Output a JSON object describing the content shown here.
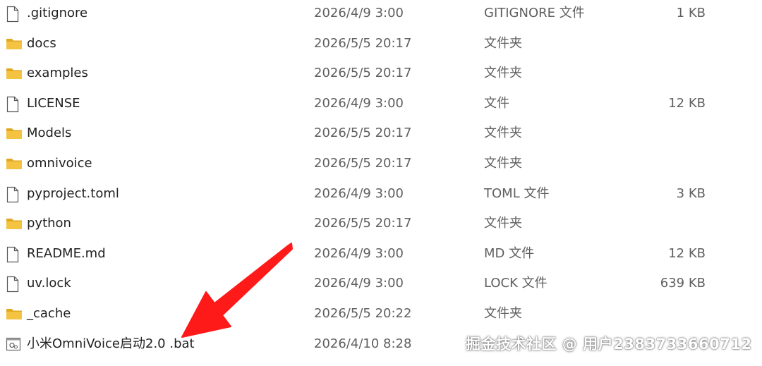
{
  "files": [
    {
      "name": ".gitignore",
      "date": "2026/4/9 3:00",
      "type": "GITIGNORE 文件",
      "size": "1 KB",
      "icon": "file-icon"
    },
    {
      "name": "docs",
      "date": "2026/5/5 20:17",
      "type": "文件夹",
      "size": "",
      "icon": "folder-icon"
    },
    {
      "name": "examples",
      "date": "2026/5/5 20:17",
      "type": "文件夹",
      "size": "",
      "icon": "folder-icon"
    },
    {
      "name": "LICENSE",
      "date": "2026/4/9 3:00",
      "type": "文件",
      "size": "12 KB",
      "icon": "file-icon"
    },
    {
      "name": "Models",
      "date": "2026/5/5 20:17",
      "type": "文件夹",
      "size": "",
      "icon": "folder-icon"
    },
    {
      "name": "omnivoice",
      "date": "2026/5/5 20:17",
      "type": "文件夹",
      "size": "",
      "icon": "folder-icon"
    },
    {
      "name": "pyproject.toml",
      "date": "2026/4/9 3:00",
      "type": "TOML 文件",
      "size": "3 KB",
      "icon": "file-icon"
    },
    {
      "name": "python",
      "date": "2026/5/5 20:17",
      "type": "文件夹",
      "size": "",
      "icon": "folder-icon"
    },
    {
      "name": "README.md",
      "date": "2026/4/9 3:00",
      "type": "MD 文件",
      "size": "12 KB",
      "icon": "file-icon"
    },
    {
      "name": "uv.lock",
      "date": "2026/4/9 3:00",
      "type": "LOCK 文件",
      "size": "639 KB",
      "icon": "file-icon"
    },
    {
      "name": "_cache",
      "date": "2026/5/5 20:22",
      "type": "文件夹",
      "size": "",
      "icon": "folder-icon"
    },
    {
      "name": "小米OmniVoice启动2.0 .bat",
      "date": "2026/4/10 8:28",
      "type": "",
      "size": "",
      "icon": "batch-file-icon"
    }
  ],
  "watermark": "掘金技术社区 @ 用户2383733660712",
  "colors": {
    "folder": "#f5c342",
    "folder_dark": "#e0a820",
    "arrow": "#ff1a1a",
    "text": "#1f1f1f",
    "meta_text": "#5f5f5f"
  }
}
